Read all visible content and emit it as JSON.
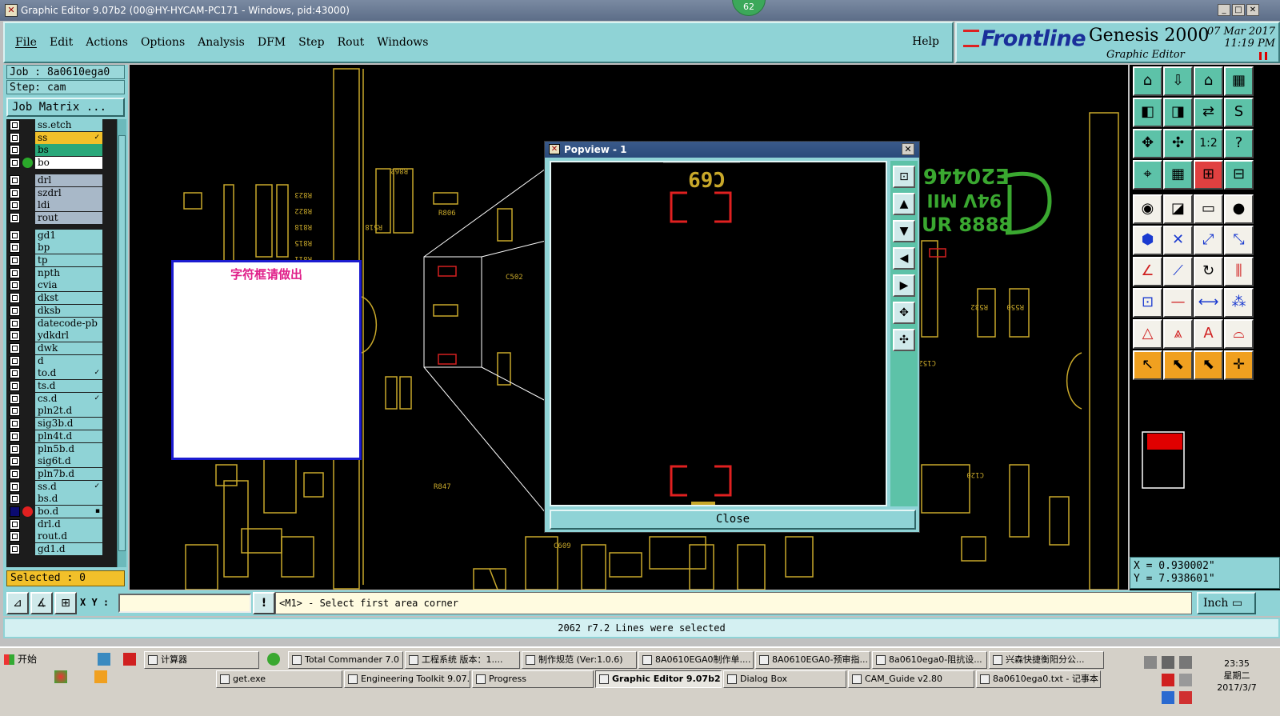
{
  "window": {
    "title": "Graphic Editor 9.07b2 (00@HY-HYCAM-PC171 - Windows, pid:43000)",
    "badge": "62"
  },
  "menu": {
    "items": [
      "File",
      "Edit",
      "Actions",
      "Options",
      "Analysis",
      "DFM",
      "Step",
      "Rout",
      "Windows"
    ],
    "help": "Help"
  },
  "brand": {
    "logo": "Frontline",
    "product": "Genesis 2000",
    "subtitle": "Graphic Editor",
    "date": "07 Mar 2017",
    "time": "11:19 PM"
  },
  "job": {
    "job_line": "Job : 8a0610ega0",
    "step_line": "Step: cam",
    "matrix_button": "Job Matrix ..."
  },
  "layers": [
    {
      "name": "ss.etch",
      "color": "#8fd3d6"
    },
    {
      "name": "ss",
      "color": "#f2c02a",
      "mark": "✓"
    },
    {
      "name": "bs",
      "color": "#2aa87a"
    },
    {
      "name": "bo",
      "color": "#ffffff",
      "dot": "#2aa82a"
    },
    {
      "name": "drl",
      "color": "#a8b8c8"
    },
    {
      "name": "szdrl",
      "color": "#a8b8c8"
    },
    {
      "name": "ldi",
      "color": "#a8b8c8"
    },
    {
      "name": "rout",
      "color": "#a8b8c8"
    },
    {
      "name": "gd1",
      "color": "#8fd3d6"
    },
    {
      "name": "bp",
      "color": "#8fd3d6"
    },
    {
      "name": "tp",
      "color": "#8fd3d6"
    },
    {
      "name": "npth",
      "color": "#8fd3d6"
    },
    {
      "name": "cvia",
      "color": "#8fd3d6"
    },
    {
      "name": "dkst",
      "color": "#8fd3d6"
    },
    {
      "name": "dksb",
      "color": "#8fd3d6"
    },
    {
      "name": "datecode-pb",
      "color": "#8fd3d6"
    },
    {
      "name": "ydkdrl",
      "color": "#8fd3d6"
    },
    {
      "name": "dwk",
      "color": "#8fd3d6"
    },
    {
      "name": "d",
      "color": "#8fd3d6"
    },
    {
      "name": "to.d",
      "color": "#8fd3d6",
      "mark": "✓"
    },
    {
      "name": "ts.d",
      "color": "#8fd3d6"
    },
    {
      "name": "cs.d",
      "color": "#8fd3d6",
      "mark": "✓"
    },
    {
      "name": "pln2t.d",
      "color": "#8fd3d6"
    },
    {
      "name": "sig3b.d",
      "color": "#8fd3d6"
    },
    {
      "name": "pln4t.d",
      "color": "#8fd3d6"
    },
    {
      "name": "pln5b.d",
      "color": "#8fd3d6"
    },
    {
      "name": "sig6t.d",
      "color": "#8fd3d6"
    },
    {
      "name": "pln7b.d",
      "color": "#8fd3d6"
    },
    {
      "name": "ss.d",
      "color": "#8fd3d6",
      "mark": "✓"
    },
    {
      "name": "bs.d",
      "color": "#8fd3d6"
    },
    {
      "name": "bo.d",
      "color": "#8fd3d6",
      "dot": "#e02020",
      "checked": true,
      "mark": "▪"
    },
    {
      "name": "drl.d",
      "color": "#8fd3d6"
    },
    {
      "name": "rout.d",
      "color": "#8fd3d6"
    },
    {
      "name": "gd1.d",
      "color": "#8fd3d6"
    }
  ],
  "selected": "Selected : 0",
  "annotation": "字符框请做出",
  "popview": {
    "title": "Popview - 1",
    "label": "C69",
    "close": "Close"
  },
  "board": {
    "marking": "E20446",
    "marking2": "94V MII S",
    "marking3": "UR 8888"
  },
  "coords": {
    "x": "X = 0.930002\"",
    "y": "Y = 7.938601\""
  },
  "command": {
    "xy_label": "X Y :",
    "xy_value": "",
    "prompt": "<M1> - Select first area corner",
    "units": "Inch"
  },
  "status": "2062 r7.2 Lines were selected",
  "taskbar": {
    "start": "开始",
    "row1": [
      "计算器",
      "Total Commander 7.0 ...",
      "工程系统  版本：1....",
      "制作规范 (Ver:1.0.6)",
      "8A0610EGA0制作单....",
      "8A0610EGA0-预审指...",
      "8a0610ega0-阻抗设...",
      "兴森快捷衡阳分公..."
    ],
    "row2": [
      "get.exe",
      "Engineering Toolkit 9.07...",
      "Progress",
      "Graphic Editor 9.07b2 ...",
      "Dialog Box",
      "CAM_Guide v2.80",
      "8a0610ega0.txt - 记事本"
    ],
    "clock_time": "23:35",
    "clock_day": "星期二",
    "clock_date": "2017/3/7"
  }
}
